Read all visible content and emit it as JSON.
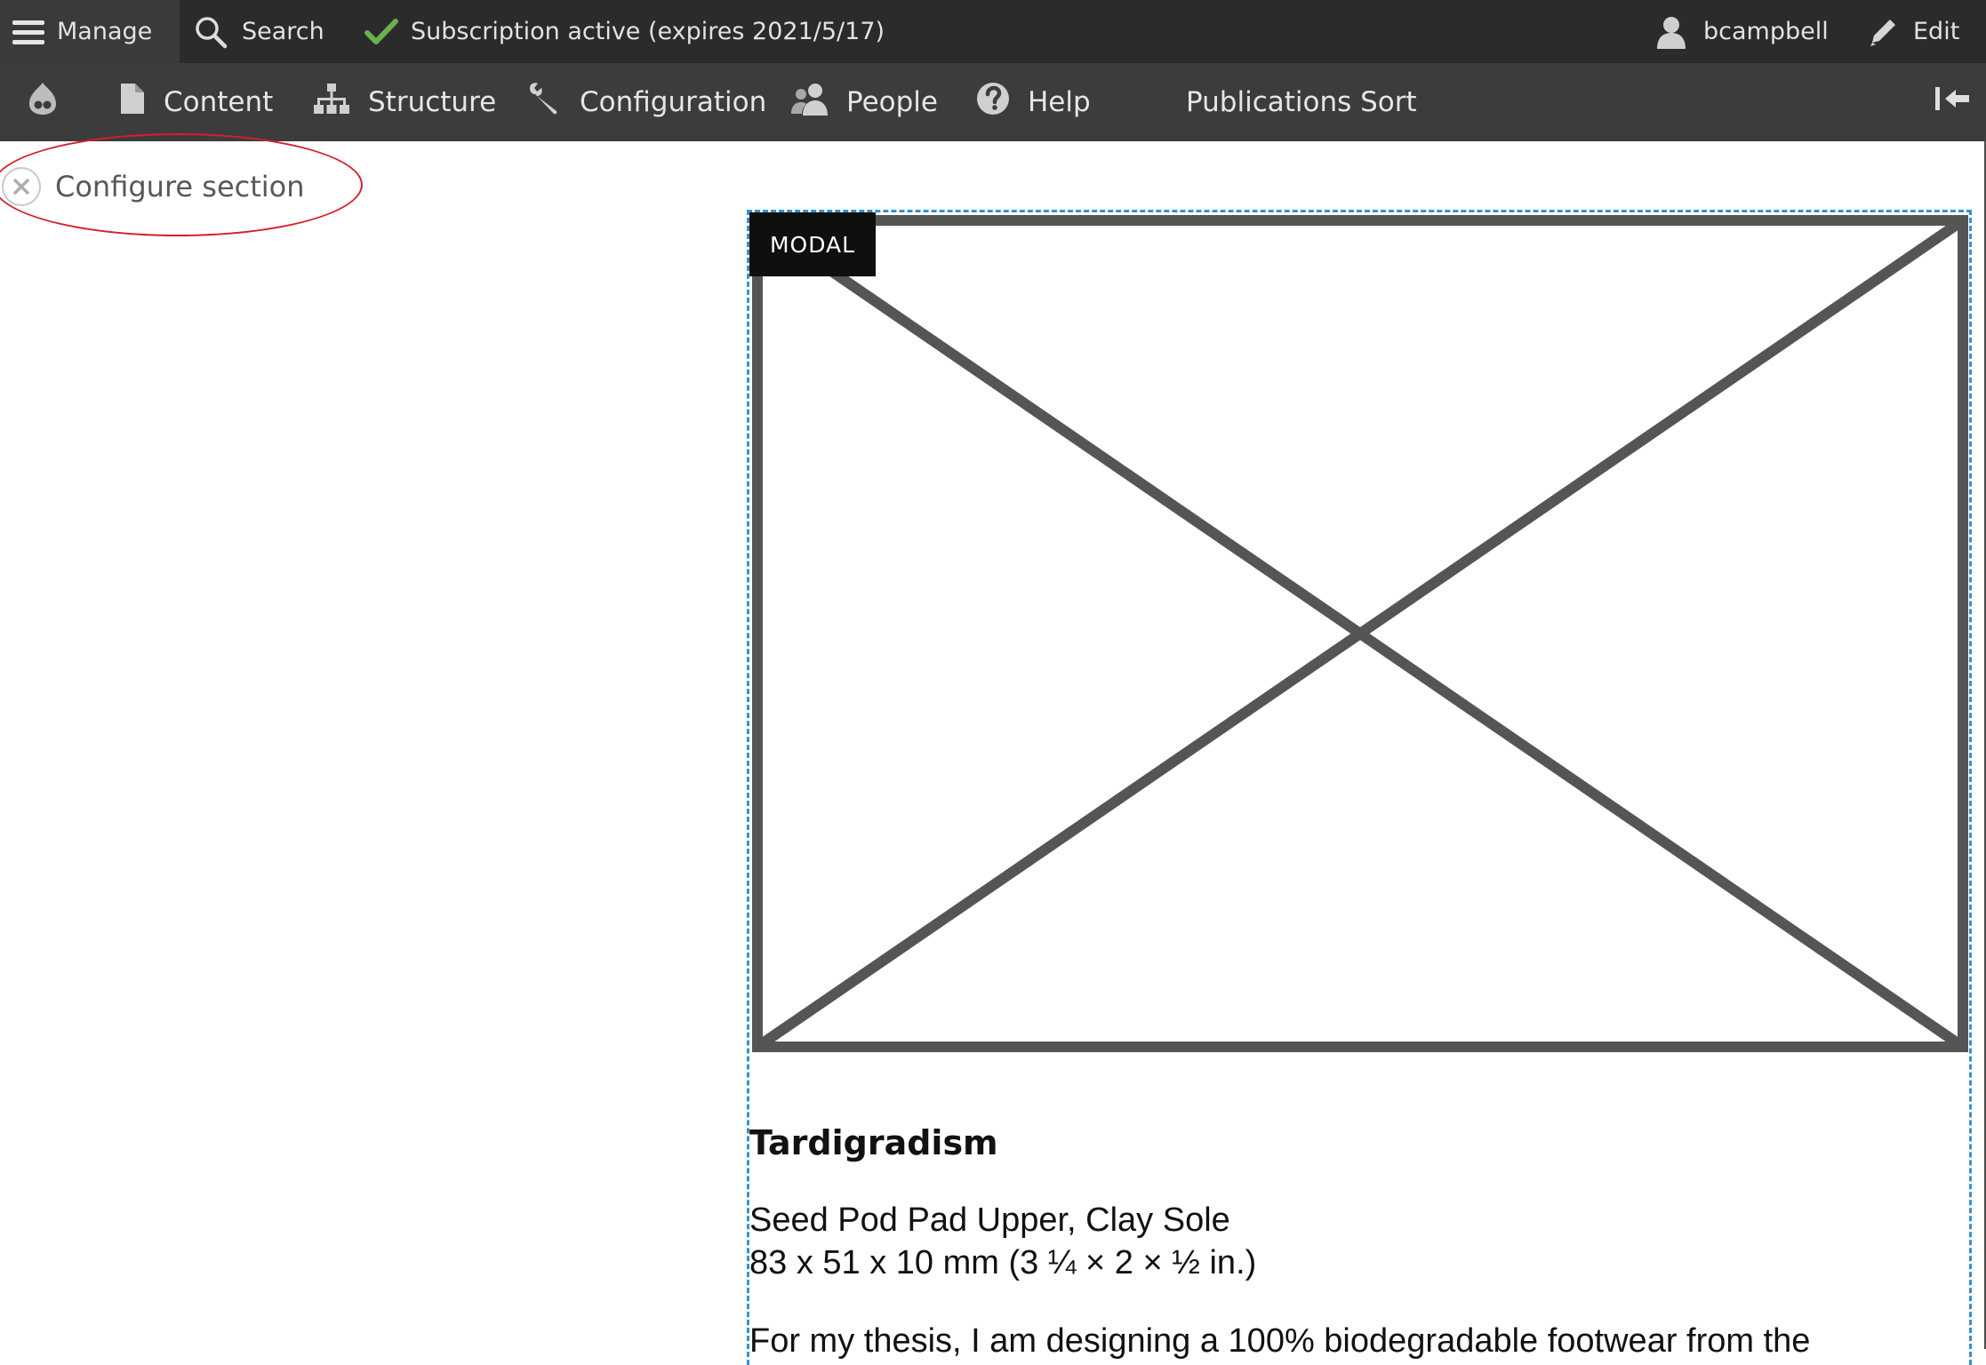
{
  "toolbar": {
    "manage_label": "Manage",
    "search_label": "Search",
    "subscription_label": "Subscription active (expires 2021/5/17)",
    "user_label": "bcampbell",
    "edit_label": "Edit"
  },
  "admin_menu": {
    "items": [
      {
        "label": "Content",
        "icon": "file-icon"
      },
      {
        "label": "Structure",
        "icon": "sitemap-icon"
      },
      {
        "label": "Configuration",
        "icon": "wrench-icon"
      },
      {
        "label": "People",
        "icon": "people-icon"
      },
      {
        "label": "Help",
        "icon": "help-icon"
      },
      {
        "label": "Publications Sort",
        "icon": ""
      }
    ]
  },
  "section": {
    "configure_label": "Configure section"
  },
  "block": {
    "tag": "MODAL",
    "title": "Tardigradism",
    "material": "Seed Pod Pad Upper, Clay Sole",
    "dimensions": "83 x 51 x 10 mm (3 ¼ × 2 × ½ in.)",
    "body": "For my thesis, I am designing a 100% biodegradable footwear from the"
  },
  "colors": {
    "toolbar_bg": "#2b2b2b",
    "menu_bg": "#3c3c3c",
    "check_green": "#6ab04c",
    "annotation_red": "#d4202a",
    "dashed_blue": "#3a8fd0"
  }
}
